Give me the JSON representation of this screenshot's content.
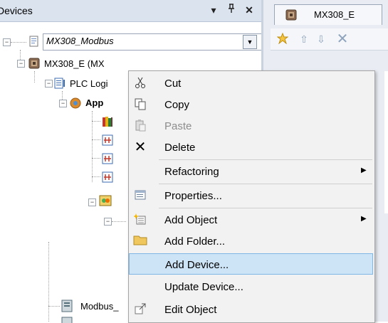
{
  "devices_panel": {
    "title": "Devices",
    "pin_glyph": "▾",
    "dock_glyph": "⊣",
    "close_glyph": "✕",
    "combo_value": "MX308_Modbus",
    "combo_arrow": "▼"
  },
  "tree": {
    "device_label": "MX308_E (MX",
    "plc_logic_label": "PLC Logi",
    "application_label": "App",
    "modbus_label": "Modbus_"
  },
  "editor": {
    "tab_label": "MX308_E",
    "toolbar_icons": [
      "star-icon",
      "up-arrow-icon",
      "down-arrow-icon",
      "delete-icon"
    ]
  },
  "context_menu": {
    "items": [
      {
        "label": "Cut",
        "icon": "cut-icon",
        "glyph": "✂",
        "enabled": true,
        "submenu": false
      },
      {
        "label": "Copy",
        "icon": "copy-icon",
        "glyph": "❐",
        "enabled": true,
        "submenu": false
      },
      {
        "label": "Paste",
        "icon": "paste-icon",
        "glyph": "📋",
        "enabled": false,
        "submenu": false
      },
      {
        "label": "Delete",
        "icon": "delete-icon",
        "glyph": "✕",
        "enabled": true,
        "submenu": false
      },
      {
        "label": "Refactoring",
        "icon": "",
        "glyph": "",
        "enabled": true,
        "submenu": true
      },
      {
        "label": "Properties...",
        "icon": "properties-icon",
        "glyph": "▤",
        "enabled": true,
        "submenu": false
      },
      {
        "label": "Add Object",
        "icon": "add-object-icon",
        "glyph": "▦",
        "enabled": true,
        "submenu": true
      },
      {
        "label": "Add Folder...",
        "icon": "folder-icon",
        "glyph": "",
        "enabled": true,
        "submenu": false
      },
      {
        "label": "Add Device...",
        "icon": "",
        "glyph": "",
        "enabled": true,
        "submenu": false,
        "highlighted": true
      },
      {
        "label": "Update Device...",
        "icon": "",
        "glyph": "",
        "enabled": true,
        "submenu": false
      },
      {
        "label": "Edit Object",
        "icon": "edit-object-icon",
        "glyph": "↗",
        "enabled": true,
        "submenu": false
      }
    ],
    "submenu_arrow": "▶"
  },
  "colors": {
    "header_bg": "#dbe3ef",
    "menu_bg": "#f2f2f2",
    "highlight_bg": "#cde4f7",
    "highlight_border": "#7fb6e4",
    "disabled_text": "#8d8d8d"
  }
}
